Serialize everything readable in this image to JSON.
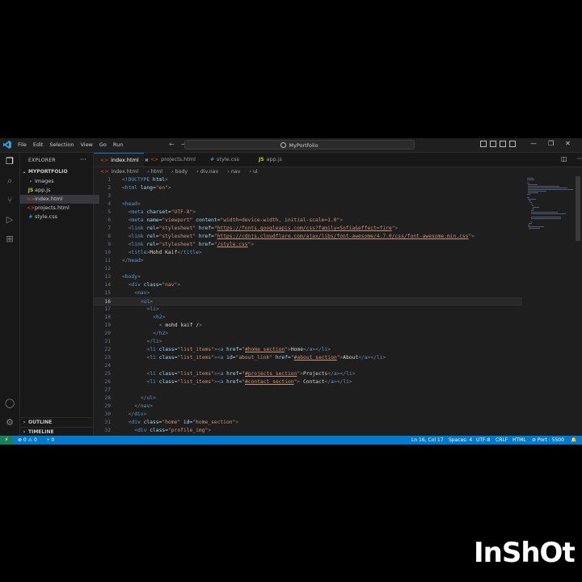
{
  "titlebar": {
    "menus": [
      "File",
      "Edit",
      "Selection",
      "View",
      "Go",
      "Run"
    ],
    "search": "MyPortfolio"
  },
  "explorer": {
    "header": "EXPLORER",
    "more": "···",
    "root": "MYPORTFOLIO",
    "items": [
      {
        "label": "images",
        "icon": "folder-chevron-icon"
      },
      {
        "label": "app.js",
        "icon": "js-icon"
      },
      {
        "label": "index.html",
        "icon": "html-icon"
      },
      {
        "label": "projects.html",
        "icon": "html-icon"
      },
      {
        "label": "style.css",
        "icon": "css-icon"
      }
    ],
    "outline": "OUTLINE",
    "timeline": "TIMELINE"
  },
  "tabs": [
    {
      "label": "index.html",
      "icon": "html-icon",
      "active": true,
      "close": "×"
    },
    {
      "label": "projects.html",
      "icon": "html-icon",
      "active": false
    },
    {
      "label": "style.css",
      "icon": "css-icon",
      "active": false
    },
    {
      "label": "app.js",
      "icon": "js-icon",
      "active": false
    }
  ],
  "breadcrumbs": [
    "index.html",
    "html",
    "body",
    "div.nav",
    "nav",
    "ul"
  ],
  "editor": {
    "current_line": 16,
    "lines": [
      {
        "n": "1",
        "indent": 0,
        "parts": [
          [
            "t-gray",
            "<"
          ],
          [
            "t-tag",
            "!DOCTYPE"
          ],
          [
            "t-attr",
            " html"
          ],
          [
            "t-gray",
            ">"
          ]
        ]
      },
      {
        "n": "2",
        "indent": 0,
        "parts": [
          [
            "t-gray",
            "<"
          ],
          [
            "t-tag",
            "html"
          ],
          [
            "t-attr",
            " lang"
          ],
          [
            "t-text",
            "="
          ],
          [
            "t-str",
            "\"en\""
          ],
          [
            "t-gray",
            ">"
          ]
        ]
      },
      {
        "n": "3",
        "indent": 0,
        "parts": []
      },
      {
        "n": "4",
        "indent": 0,
        "parts": [
          [
            "t-gray",
            "<"
          ],
          [
            "t-tag",
            "head"
          ],
          [
            "t-gray",
            ">"
          ]
        ]
      },
      {
        "n": "5",
        "indent": 2,
        "parts": [
          [
            "t-gray",
            "<"
          ],
          [
            "t-tag",
            "meta"
          ],
          [
            "t-attr",
            " charset"
          ],
          [
            "t-text",
            "="
          ],
          [
            "t-str",
            "\"UTF-8\""
          ],
          [
            "t-gray",
            ">"
          ]
        ]
      },
      {
        "n": "6",
        "indent": 2,
        "parts": [
          [
            "t-gray",
            "<"
          ],
          [
            "t-tag",
            "meta"
          ],
          [
            "t-attr",
            " name"
          ],
          [
            "t-text",
            "="
          ],
          [
            "t-str",
            "\"viewport\""
          ],
          [
            "t-attr",
            " content"
          ],
          [
            "t-text",
            "="
          ],
          [
            "t-str",
            "\"width=device-width, initial-scale=1.0\""
          ],
          [
            "t-gray",
            ">"
          ]
        ]
      },
      {
        "n": "7",
        "indent": 2,
        "parts": [
          [
            "t-gray",
            "<"
          ],
          [
            "t-tag",
            "link"
          ],
          [
            "t-attr",
            " rel"
          ],
          [
            "t-text",
            "="
          ],
          [
            "t-str",
            "\"stylesheet\""
          ],
          [
            "t-attr",
            " href"
          ],
          [
            "t-text",
            "="
          ],
          [
            "t-str",
            "\""
          ],
          [
            "t-url",
            "https://fonts.googleapis.com/css?family=Sofia&effect=fire"
          ],
          [
            "t-str",
            "\""
          ],
          [
            "t-gray",
            ">"
          ]
        ]
      },
      {
        "n": "8",
        "indent": 2,
        "parts": [
          [
            "t-gray",
            "<"
          ],
          [
            "t-tag",
            "link"
          ],
          [
            "t-attr",
            " rel"
          ],
          [
            "t-text",
            "="
          ],
          [
            "t-str",
            "\"stylesheet\""
          ],
          [
            "t-attr",
            " href"
          ],
          [
            "t-text",
            "="
          ],
          [
            "t-str",
            "\""
          ],
          [
            "t-url",
            "https://cdnjs.cloudflare.com/ajax/libs/font-awesome/4.7.0/css/font-awesome.min.css"
          ],
          [
            "t-str",
            "\""
          ],
          [
            "t-gray",
            ">"
          ]
        ]
      },
      {
        "n": "9",
        "indent": 2,
        "parts": [
          [
            "t-gray",
            "<"
          ],
          [
            "t-tag",
            "link"
          ],
          [
            "t-attr",
            " rel"
          ],
          [
            "t-text",
            "="
          ],
          [
            "t-str",
            "\"stylesheet\""
          ],
          [
            "t-attr",
            " href"
          ],
          [
            "t-text",
            "="
          ],
          [
            "t-str",
            "\""
          ],
          [
            "t-url",
            "/style.css"
          ],
          [
            "t-str",
            "\""
          ],
          [
            "t-gray",
            ">"
          ]
        ]
      },
      {
        "n": "10",
        "indent": 2,
        "parts": [
          [
            "t-gray",
            "<"
          ],
          [
            "t-tag",
            "title"
          ],
          [
            "t-gray",
            ">"
          ],
          [
            "t-text",
            "Mohd Kaif"
          ],
          [
            "t-gray",
            "</"
          ],
          [
            "t-tag",
            "title"
          ],
          [
            "t-gray",
            ">"
          ]
        ]
      },
      {
        "n": "11",
        "indent": 0,
        "parts": [
          [
            "t-gray",
            "</"
          ],
          [
            "t-tag",
            "head"
          ],
          [
            "t-gray",
            ">"
          ]
        ]
      },
      {
        "n": "12",
        "indent": 0,
        "parts": []
      },
      {
        "n": "13",
        "indent": 0,
        "parts": [
          [
            "t-gray",
            "<"
          ],
          [
            "t-tag",
            "body"
          ],
          [
            "t-gray",
            ">"
          ]
        ]
      },
      {
        "n": "14",
        "indent": 2,
        "parts": [
          [
            "t-gray",
            "<"
          ],
          [
            "t-tag",
            "div"
          ],
          [
            "t-attr",
            " class"
          ],
          [
            "t-text",
            "="
          ],
          [
            "t-str",
            "\"nav\""
          ],
          [
            "t-gray",
            ">"
          ]
        ]
      },
      {
        "n": "15",
        "indent": 4,
        "parts": [
          [
            "t-gray",
            "<"
          ],
          [
            "t-tag",
            "nav"
          ],
          [
            "t-gray",
            ">"
          ]
        ]
      },
      {
        "n": "16",
        "indent": 6,
        "parts": [
          [
            "t-gray",
            "<"
          ],
          [
            "t-tag",
            "ul"
          ],
          [
            "t-gray",
            ">"
          ]
        ]
      },
      {
        "n": "17",
        "indent": 8,
        "parts": [
          [
            "t-gray",
            "<"
          ],
          [
            "t-tag",
            "li"
          ],
          [
            "t-gray",
            ">"
          ]
        ]
      },
      {
        "n": "18",
        "indent": 10,
        "parts": [
          [
            "t-gray",
            "<"
          ],
          [
            "t-tag",
            "h2"
          ],
          [
            "t-gray",
            ">"
          ]
        ]
      },
      {
        "n": "19",
        "indent": 12,
        "parts": [
          [
            "t-gray",
            "< "
          ],
          [
            "t-text",
            "mohd kaif /"
          ],
          [
            "t-gray",
            ">"
          ]
        ]
      },
      {
        "n": "20",
        "indent": 10,
        "parts": [
          [
            "t-gray",
            "</"
          ],
          [
            "t-tag",
            "h2"
          ],
          [
            "t-gray",
            ">"
          ]
        ]
      },
      {
        "n": "21",
        "indent": 8,
        "parts": [
          [
            "t-gray",
            "</"
          ],
          [
            "t-tag",
            "li"
          ],
          [
            "t-gray",
            ">"
          ]
        ]
      },
      {
        "n": "22",
        "indent": 8,
        "parts": [
          [
            "t-gray",
            "<"
          ],
          [
            "t-tag",
            "li"
          ],
          [
            "t-attr",
            " class"
          ],
          [
            "t-text",
            "="
          ],
          [
            "t-str",
            "\"list_items\""
          ],
          [
            "t-gray",
            "><"
          ],
          [
            "t-tag",
            "a"
          ],
          [
            "t-attr",
            " href"
          ],
          [
            "t-text",
            "="
          ],
          [
            "t-str",
            "\""
          ],
          [
            "t-url",
            "#home_section"
          ],
          [
            "t-str",
            "\""
          ],
          [
            "t-gray",
            ">"
          ],
          [
            "t-text",
            "Home"
          ],
          [
            "t-gray",
            "</"
          ],
          [
            "t-tag",
            "a"
          ],
          [
            "t-gray",
            "></"
          ],
          [
            "t-tag",
            "li"
          ],
          [
            "t-gray",
            ">"
          ]
        ]
      },
      {
        "n": "23",
        "indent": 8,
        "parts": [
          [
            "t-gray",
            "<"
          ],
          [
            "t-tag",
            "li"
          ],
          [
            "t-attr",
            " class"
          ],
          [
            "t-text",
            "="
          ],
          [
            "t-str",
            "\"list_items\""
          ],
          [
            "t-gray",
            "><"
          ],
          [
            "t-tag",
            "a"
          ],
          [
            "t-attr",
            " id"
          ],
          [
            "t-text",
            "="
          ],
          [
            "t-str",
            "\"about_link\""
          ],
          [
            "t-attr",
            " href"
          ],
          [
            "t-text",
            "="
          ],
          [
            "t-str",
            "\""
          ],
          [
            "t-url",
            "#about_section"
          ],
          [
            "t-str",
            "\""
          ],
          [
            "t-gray",
            ">"
          ],
          [
            "t-text",
            "About"
          ],
          [
            "t-gray",
            "</"
          ],
          [
            "t-tag",
            "a"
          ],
          [
            "t-gray",
            "></"
          ],
          [
            "t-tag",
            "li"
          ],
          [
            "t-gray",
            ">"
          ]
        ]
      },
      {
        "n": "24",
        "indent": 0,
        "parts": []
      },
      {
        "n": "25",
        "indent": 8,
        "parts": [
          [
            "t-gray",
            "<"
          ],
          [
            "t-tag",
            "li"
          ],
          [
            "t-attr",
            " class"
          ],
          [
            "t-text",
            "="
          ],
          [
            "t-str",
            "\"list_items\""
          ],
          [
            "t-gray",
            "><"
          ],
          [
            "t-tag",
            "a"
          ],
          [
            "t-attr",
            " href"
          ],
          [
            "t-text",
            "="
          ],
          [
            "t-str",
            "\""
          ],
          [
            "t-url",
            "#projects_section"
          ],
          [
            "t-str",
            "\""
          ],
          [
            "t-gray",
            ">"
          ],
          [
            "t-text",
            "Projects"
          ],
          [
            "t-gray",
            "</"
          ],
          [
            "t-tag",
            "a"
          ],
          [
            "t-gray",
            "></"
          ],
          [
            "t-tag",
            "li"
          ],
          [
            "t-gray",
            ">"
          ]
        ]
      },
      {
        "n": "26",
        "indent": 8,
        "parts": [
          [
            "t-gray",
            "<"
          ],
          [
            "t-tag",
            "li"
          ],
          [
            "t-attr",
            " class"
          ],
          [
            "t-text",
            "="
          ],
          [
            "t-str",
            "\"list_items\""
          ],
          [
            "t-gray",
            "><"
          ],
          [
            "t-tag",
            "a"
          ],
          [
            "t-attr",
            " href"
          ],
          [
            "t-text",
            "="
          ],
          [
            "t-str",
            "\""
          ],
          [
            "t-url",
            "#contact_section"
          ],
          [
            "t-str",
            "\""
          ],
          [
            "t-gray",
            ">"
          ],
          [
            "t-text",
            " Contact"
          ],
          [
            "t-gray",
            "</"
          ],
          [
            "t-tag",
            "a"
          ],
          [
            "t-gray",
            "></"
          ],
          [
            "t-tag",
            "li"
          ],
          [
            "t-gray",
            ">"
          ]
        ]
      },
      {
        "n": "27",
        "indent": 0,
        "parts": []
      },
      {
        "n": "28",
        "indent": 6,
        "parts": [
          [
            "t-gray",
            "</"
          ],
          [
            "t-tag",
            "ul"
          ],
          [
            "t-gray",
            ">"
          ]
        ]
      },
      {
        "n": "29",
        "indent": 4,
        "parts": [
          [
            "t-gray",
            "</"
          ],
          [
            "t-tag",
            "nav"
          ],
          [
            "t-gray",
            ">"
          ]
        ]
      },
      {
        "n": "30",
        "indent": 2,
        "parts": [
          [
            "t-gray",
            "</"
          ],
          [
            "t-tag",
            "div"
          ],
          [
            "t-gray",
            ">"
          ]
        ]
      },
      {
        "n": "31",
        "indent": 2,
        "parts": [
          [
            "t-gray",
            "<"
          ],
          [
            "t-tag",
            "div"
          ],
          [
            "t-attr",
            " class"
          ],
          [
            "t-text",
            "="
          ],
          [
            "t-str",
            "\"home\""
          ],
          [
            "t-attr",
            " id"
          ],
          [
            "t-text",
            "="
          ],
          [
            "t-str",
            "\"home_section\""
          ],
          [
            "t-gray",
            ">"
          ]
        ]
      },
      {
        "n": "32",
        "indent": 4,
        "parts": [
          [
            "t-gray",
            "<"
          ],
          [
            "t-tag",
            "div"
          ],
          [
            "t-attr",
            " class"
          ],
          [
            "t-text",
            "="
          ],
          [
            "t-str",
            "\"profile_img\""
          ],
          [
            "t-gray",
            ">"
          ]
        ]
      }
    ]
  },
  "statusbar": {
    "remote": "⚡",
    "errors": "⊗ 0 ⚠ 0",
    "ports": "⑂ 0",
    "position": "Ln 16, Col 17",
    "spaces": "Spaces: 4",
    "encoding": "UTF-8",
    "eol": "CRLF",
    "language": "HTML",
    "port": "⊘ Port : 5500",
    "bell": "🔔"
  },
  "watermark": "InShOt",
  "colors": {
    "accent": "#007acc",
    "editor_bg": "#1e1e1e",
    "tag": "#569cd6",
    "attr": "#9cdcfe",
    "string": "#ce9178"
  }
}
